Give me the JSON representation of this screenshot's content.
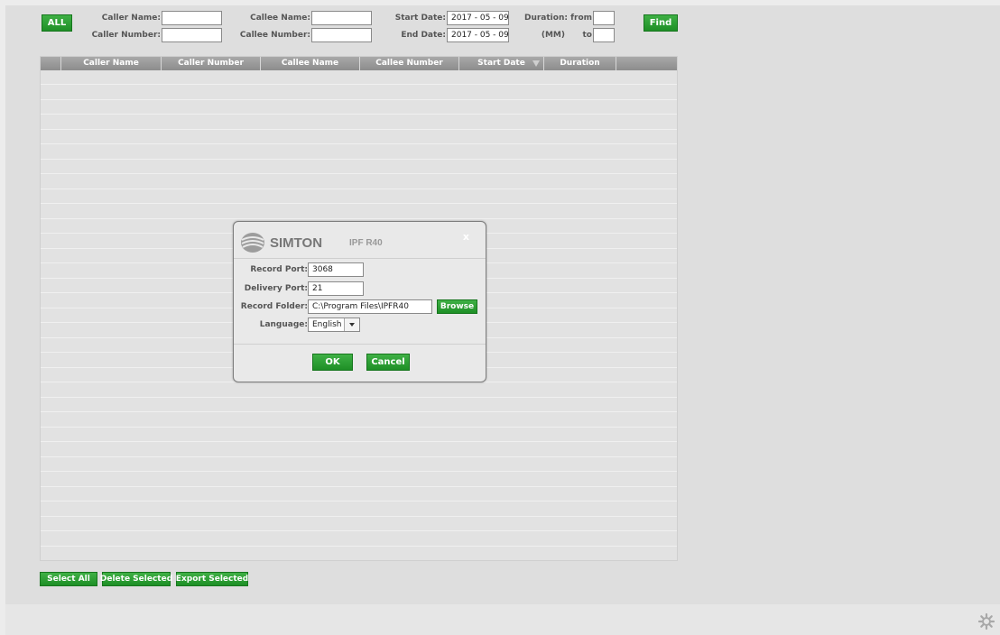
{
  "filters": {
    "all_label": "ALL",
    "caller_name_label": "Caller Name:",
    "caller_number_label": "Caller Number:",
    "callee_name_label": "Callee Name:",
    "callee_number_label": "Callee Number:",
    "start_date_label": "Start Date:",
    "end_date_label": "End Date:",
    "start_date_value": "2017 - 05 - 09",
    "end_date_value": "2017 - 05 - 09",
    "duration_from_label": "Duration: from",
    "duration_unit_label": "(MM)",
    "duration_to_label": "to",
    "find_label": "Find"
  },
  "table": {
    "columns": [
      "Caller Name",
      "Caller Number",
      "Callee Name",
      "Callee Number",
      "Start Date",
      "Duration"
    ]
  },
  "actions": {
    "select_all": "Select All",
    "delete_selected": "Delete Selected",
    "export_selected": "Export Selected"
  },
  "dialog": {
    "brand": "SIMTON",
    "model": "IPF R40",
    "close": "x",
    "record_port_label": "Record Port:",
    "record_port_value": "3068",
    "delivery_port_label": "Delivery Port:",
    "delivery_port_value": "21",
    "record_folder_label": "Record Folder:",
    "record_folder_value": "C:\\Program Files\\IPFR40",
    "browse_label": "Browse",
    "language_label": "Language:",
    "language_value": "English",
    "ok_label": "OK",
    "cancel_label": "Cancel"
  },
  "icons": {
    "settings": "gear-icon",
    "sort": "sort-desc-icon",
    "dropdown": "chevron-down-icon",
    "logo": "simton-logo"
  },
  "colors": {
    "accent_green": "#2a9e32",
    "header_gray": "#9a9a9a",
    "background": "#dedede"
  }
}
